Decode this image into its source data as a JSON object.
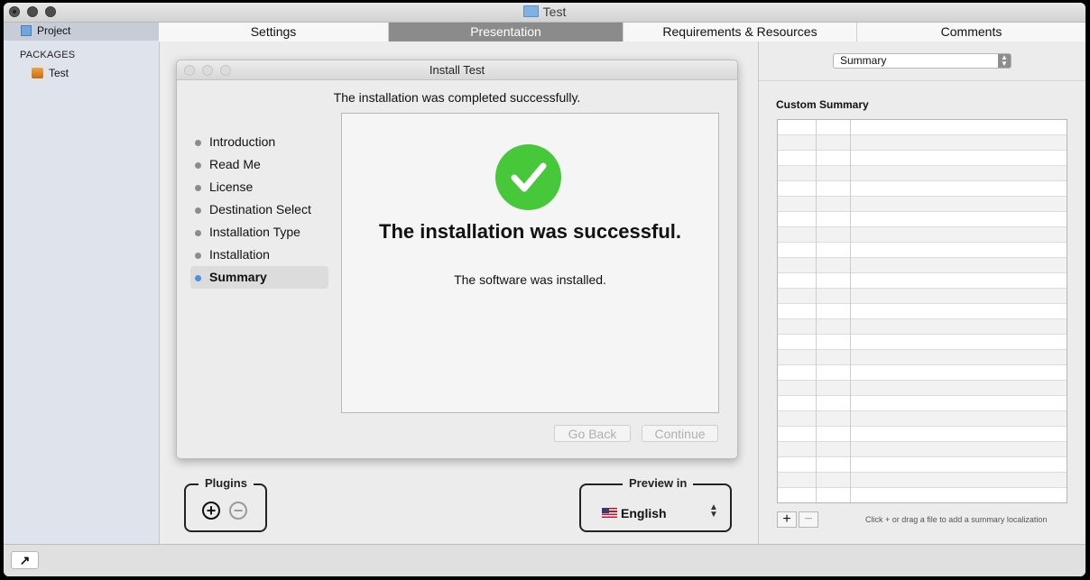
{
  "window": {
    "title": "Test"
  },
  "sidebar": {
    "project_label": "Project",
    "packages_heading": "PACKAGES",
    "package_name": "Test"
  },
  "tabs": [
    {
      "label": "Settings"
    },
    {
      "label": "Presentation",
      "active": true
    },
    {
      "label": "Requirements & Resources"
    },
    {
      "label": "Comments"
    }
  ],
  "dialog": {
    "title": "Install Test",
    "headline": "The installation was completed successfully.",
    "steps": [
      {
        "label": "Introduction"
      },
      {
        "label": "Read Me"
      },
      {
        "label": "License"
      },
      {
        "label": "Destination Select"
      },
      {
        "label": "Installation Type"
      },
      {
        "label": "Installation"
      },
      {
        "label": "Summary",
        "current": true
      }
    ],
    "success_title": "The installation was successful.",
    "success_subtitle": "The software was installed.",
    "back_label": "Go Back",
    "continue_label": "Continue"
  },
  "plugins": {
    "label": "Plugins",
    "add": "+",
    "remove": "−"
  },
  "preview": {
    "label": "Preview in",
    "language": "English"
  },
  "right_panel": {
    "popup_value": "Summary",
    "custom_summary_label": "Custom Summary",
    "add": "+",
    "remove": "−",
    "hint": "Click + or drag a file to add a summary localization"
  },
  "bottom": {
    "arrow": "↗"
  }
}
